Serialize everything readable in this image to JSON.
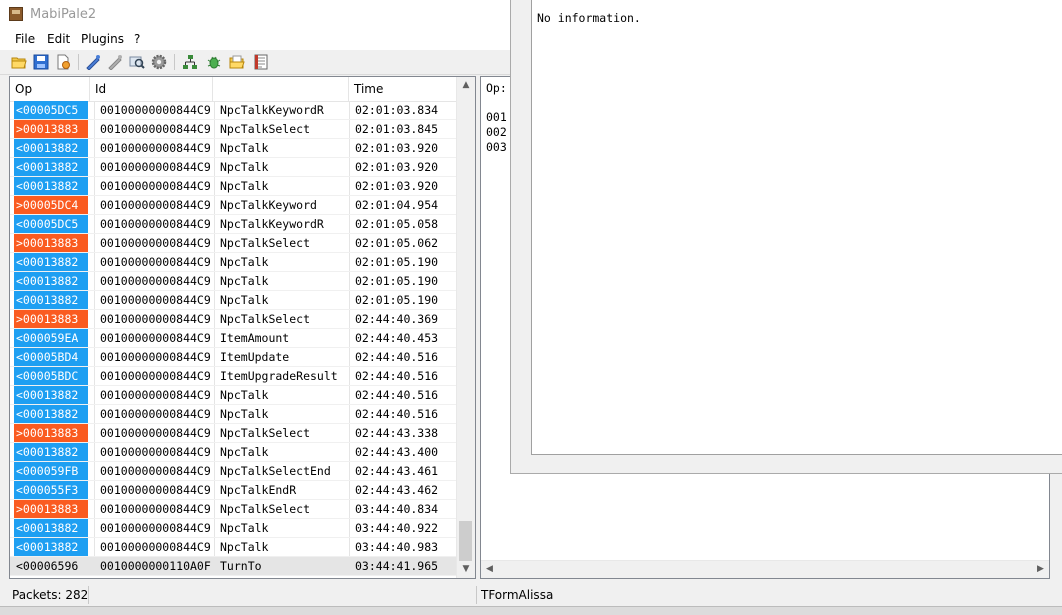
{
  "window": {
    "title": "MabiPale2"
  },
  "menu": [
    {
      "label": "File"
    },
    {
      "label": "Edit"
    },
    {
      "label": "Plugins"
    },
    {
      "label": "?"
    }
  ],
  "toolbar": [
    {
      "icon": "open-folder-icon"
    },
    {
      "icon": "save-icon"
    },
    {
      "icon": "clear-icon"
    },
    {
      "icon": "connect-icon"
    },
    {
      "icon": "disconnect-icon"
    },
    {
      "icon": "search-icon"
    },
    {
      "icon": "settings-icon"
    },
    {
      "icon": "tree-icon"
    },
    {
      "icon": "bug-icon"
    },
    {
      "icon": "folder-open-icon"
    },
    {
      "icon": "notes-icon"
    }
  ],
  "packets": {
    "columns": [
      "Op",
      "Id",
      "",
      "Time"
    ],
    "rows": [
      {
        "op": "<00005DC5",
        "dir": "recv",
        "id": "00100000000844C9",
        "name": "NpcTalkKeywordR",
        "time": "02:01:03.834"
      },
      {
        "op": ">00013883",
        "dir": "send",
        "id": "00100000000844C9",
        "name": "NpcTalkSelect",
        "time": "02:01:03.845"
      },
      {
        "op": "<00013882",
        "dir": "recv",
        "id": "00100000000844C9",
        "name": "NpcTalk",
        "time": "02:01:03.920"
      },
      {
        "op": "<00013882",
        "dir": "recv",
        "id": "00100000000844C9",
        "name": "NpcTalk",
        "time": "02:01:03.920"
      },
      {
        "op": "<00013882",
        "dir": "recv",
        "id": "00100000000844C9",
        "name": "NpcTalk",
        "time": "02:01:03.920"
      },
      {
        "op": ">00005DC4",
        "dir": "send",
        "id": "00100000000844C9",
        "name": "NpcTalkKeyword",
        "time": "02:01:04.954"
      },
      {
        "op": "<00005DC5",
        "dir": "recv",
        "id": "00100000000844C9",
        "name": "NpcTalkKeywordR",
        "time": "02:01:05.058"
      },
      {
        "op": ">00013883",
        "dir": "send",
        "id": "00100000000844C9",
        "name": "NpcTalkSelect",
        "time": "02:01:05.062"
      },
      {
        "op": "<00013882",
        "dir": "recv",
        "id": "00100000000844C9",
        "name": "NpcTalk",
        "time": "02:01:05.190"
      },
      {
        "op": "<00013882",
        "dir": "recv",
        "id": "00100000000844C9",
        "name": "NpcTalk",
        "time": "02:01:05.190"
      },
      {
        "op": "<00013882",
        "dir": "recv",
        "id": "00100000000844C9",
        "name": "NpcTalk",
        "time": "02:01:05.190"
      },
      {
        "op": ">00013883",
        "dir": "send",
        "id": "00100000000844C9",
        "name": "NpcTalkSelect",
        "time": "02:44:40.369"
      },
      {
        "op": "<000059EA",
        "dir": "recv",
        "id": "00100000000844C9",
        "name": "ItemAmount",
        "time": "02:44:40.453"
      },
      {
        "op": "<00005BD4",
        "dir": "recv",
        "id": "00100000000844C9",
        "name": "ItemUpdate",
        "time": "02:44:40.516"
      },
      {
        "op": "<00005BDC",
        "dir": "recv",
        "id": "00100000000844C9",
        "name": "ItemUpgradeResult",
        "time": "02:44:40.516"
      },
      {
        "op": "<00013882",
        "dir": "recv",
        "id": "00100000000844C9",
        "name": "NpcTalk",
        "time": "02:44:40.516"
      },
      {
        "op": "<00013882",
        "dir": "recv",
        "id": "00100000000844C9",
        "name": "NpcTalk",
        "time": "02:44:40.516"
      },
      {
        "op": ">00013883",
        "dir": "send",
        "id": "00100000000844C9",
        "name": "NpcTalkSelect",
        "time": "02:44:43.338"
      },
      {
        "op": "<00013882",
        "dir": "recv",
        "id": "00100000000844C9",
        "name": "NpcTalk",
        "time": "02:44:43.400"
      },
      {
        "op": "<000059FB",
        "dir": "recv",
        "id": "00100000000844C9",
        "name": "NpcTalkSelectEnd",
        "time": "02:44:43.461"
      },
      {
        "op": "<000055F3",
        "dir": "recv",
        "id": "00100000000844C9",
        "name": "NpcTalkEndR",
        "time": "02:44:43.462"
      },
      {
        "op": ">00013883",
        "dir": "send",
        "id": "00100000000844C9",
        "name": "NpcTalkSelect",
        "time": "03:44:40.834"
      },
      {
        "op": "<00013882",
        "dir": "recv",
        "id": "00100000000844C9",
        "name": "NpcTalk",
        "time": "03:44:40.922"
      },
      {
        "op": "<00013882",
        "dir": "recv",
        "id": "00100000000844C9",
        "name": "NpcTalk",
        "time": "03:44:40.983"
      },
      {
        "op": "<00006596",
        "dir": "none",
        "id": "0010000000110A0F",
        "name": "TurnTo",
        "time": "03:44:41.965",
        "selected": true
      }
    ]
  },
  "detail": {
    "header": "Op:",
    "lines": [
      "001",
      "002",
      "003"
    ]
  },
  "info_window": {
    "text": "No information."
  },
  "status": {
    "packets": "Packets: 282",
    "form": "TFormAlissa"
  },
  "colors": {
    "recv": "#1e9ff2",
    "send": "#fa5b20",
    "selected_row": "#e5e5e5"
  }
}
